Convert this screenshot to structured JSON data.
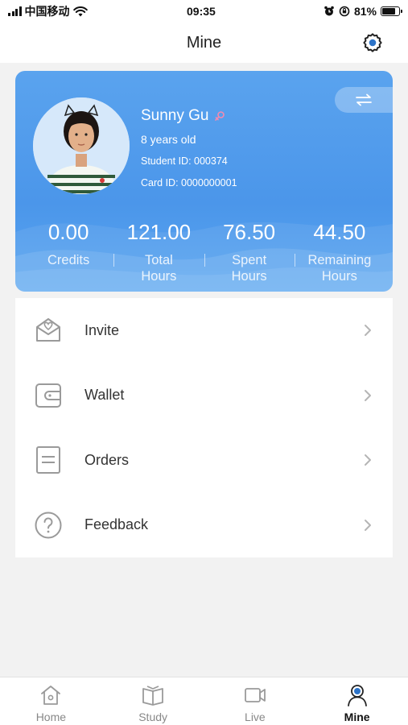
{
  "status_bar": {
    "carrier": "中国移动",
    "time": "09:35",
    "battery": "81%",
    "battery_level": 0.81
  },
  "nav": {
    "title": "Mine",
    "settings_icon": "gear-icon"
  },
  "profile": {
    "name": "Sunny Gu",
    "gender_icon": "female-symbol-icon",
    "age": "8 years old",
    "student_id": "Student ID: 000374",
    "card_id": "Card ID: 0000000001",
    "switch_icon": "swap-arrows-icon"
  },
  "stats": [
    {
      "value": "0.00",
      "label": "Credits"
    },
    {
      "value": "121.00",
      "label": "Total Hours"
    },
    {
      "value": "76.50",
      "label": "Spent Hours"
    },
    {
      "value": "44.50",
      "label": "Remaining Hours"
    }
  ],
  "menu": [
    {
      "label": "Invite",
      "icon": "envelope-heart-icon"
    },
    {
      "label": "Wallet",
      "icon": "wallet-icon"
    },
    {
      "label": "Orders",
      "icon": "document-icon"
    },
    {
      "label": "Feedback",
      "icon": "question-circle-icon"
    }
  ],
  "tabs": [
    {
      "label": "Home",
      "icon": "home-icon",
      "active": false
    },
    {
      "label": "Study",
      "icon": "book-icon",
      "active": false
    },
    {
      "label": "Live",
      "icon": "video-camera-icon",
      "active": false
    },
    {
      "label": "Mine",
      "icon": "person-icon",
      "active": true
    }
  ],
  "colors": {
    "card_blue": "#4b96ea",
    "active_tab_icon": "#2c73c8",
    "inactive": "#9a9a9a"
  }
}
